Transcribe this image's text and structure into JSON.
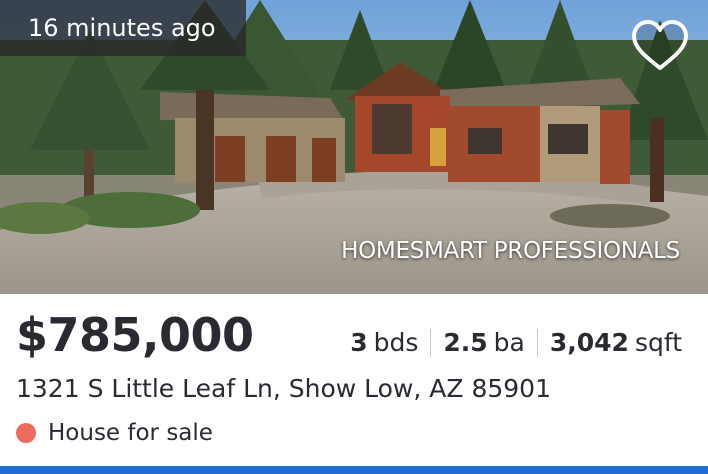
{
  "listing": {
    "time_ago": "16 minutes ago",
    "brokerage": "HOMESMART PROFESSIONALS",
    "price": "$785,000",
    "beds_value": "3",
    "beds_unit": "bds",
    "baths_value": "2.5",
    "baths_unit": "ba",
    "sqft_value": "3,042",
    "sqft_unit": "sqft",
    "address": "1321 S Little Leaf Ln, Show Low, AZ 85901",
    "status": "House for sale",
    "favorite_icon": "heart-outline-icon"
  },
  "colors": {
    "status_dot": "#ee6a5f",
    "accent_bar": "#1f6ed4",
    "text": "#2a2a33"
  }
}
